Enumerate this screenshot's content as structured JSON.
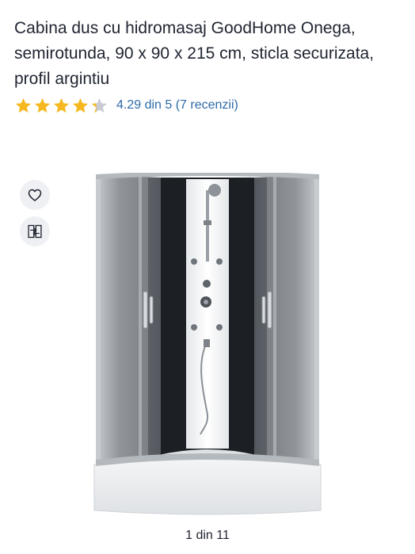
{
  "product": {
    "title": "Cabina dus cu hidromasaj GoodHome Onega, semirotunda, 90 x 90 x 215 cm, sticla securizata, profil argintiu",
    "rating_text": "4.29 din 5 (7 recenzii)",
    "rating_value": 4.29,
    "rating_max": 5,
    "review_count": 7
  },
  "actions": {
    "wishlist_icon": "heart-icon",
    "compare_icon": "compare-icon"
  },
  "gallery": {
    "counter": "1 din 11",
    "current": 1,
    "total": 11
  },
  "colors": {
    "star_filled": "#f5b820",
    "star_empty": "#c9cdd3",
    "link": "#2d6ba8",
    "text": "#1f2430"
  }
}
